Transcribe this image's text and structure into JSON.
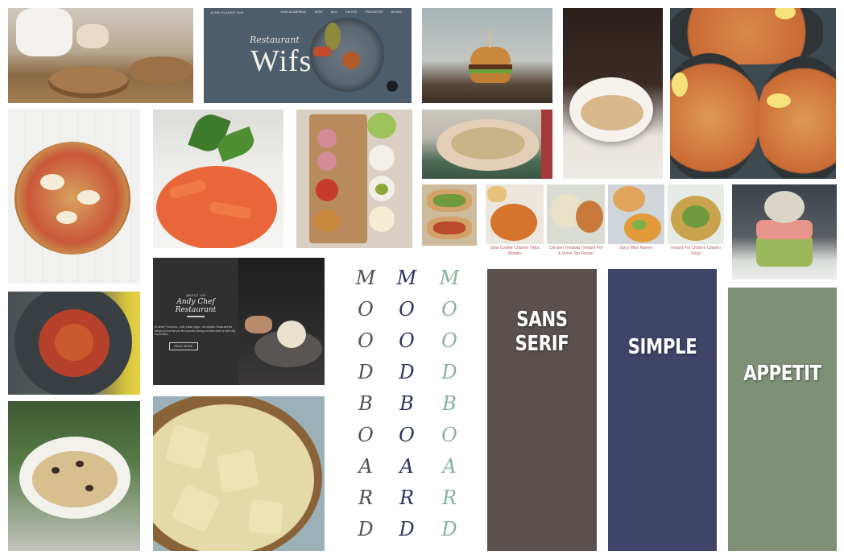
{
  "colors": {
    "swatch_brown": "#5a514f",
    "swatch_navy": "#3f4468",
    "swatch_sage": "#7e9176",
    "moodboard_dark": "#554e4e",
    "moodboard_navy": "#2e3262",
    "moodboard_sage": "#86b29a"
  },
  "restaurant_website": {
    "logo_small": "JOHN SLADER KUK",
    "nav": [
      "JOHN SLADERKUK",
      "MENY",
      "BILD",
      "OM OSS",
      "PRODUKTER",
      "BOOKS"
    ],
    "script_title": "Restaurant",
    "brand_name": "Wifs"
  },
  "about_card": {
    "eyebrow": "ABOUT US",
    "title_line1": "Andy Chef",
    "title_line2": "Restaurant",
    "body": "Al dente? You know – milk, bread, eggs – the staples. Pasta and the things you eat that you find yourself coming out each week or each day to purchase.",
    "button": "READ MORE"
  },
  "recipe_cards": [
    {
      "caption": "Slow Cooker Chicken Tikka Masala"
    },
    {
      "caption": "Chicken Tinolang | Instant Pot & Stove Top Recipe"
    },
    {
      "caption": "Spicy Miso Ramen"
    },
    {
      "caption": "Instant Pot Chicken Cilantro Soup"
    }
  ],
  "moodboard_columns": [
    {
      "letters": [
        "M",
        "O",
        "O",
        "D",
        "B",
        "O",
        "A",
        "R",
        "D"
      ],
      "color": "#554e4e"
    },
    {
      "letters": [
        "M",
        "O",
        "O",
        "D",
        "B",
        "O",
        "A",
        "R",
        "D"
      ],
      "color": "#2e3262"
    },
    {
      "letters": [
        "M",
        "O",
        "O",
        "D",
        "B",
        "O",
        "A",
        "R",
        "D"
      ],
      "color": "#86b29a"
    }
  ],
  "swatches": [
    {
      "label": "SANS SERIF",
      "color": "#5a514f"
    },
    {
      "label": "SIMPLE",
      "color": "#3f4468"
    },
    {
      "label": "APPETIT",
      "color": "#7e9176"
    }
  ]
}
